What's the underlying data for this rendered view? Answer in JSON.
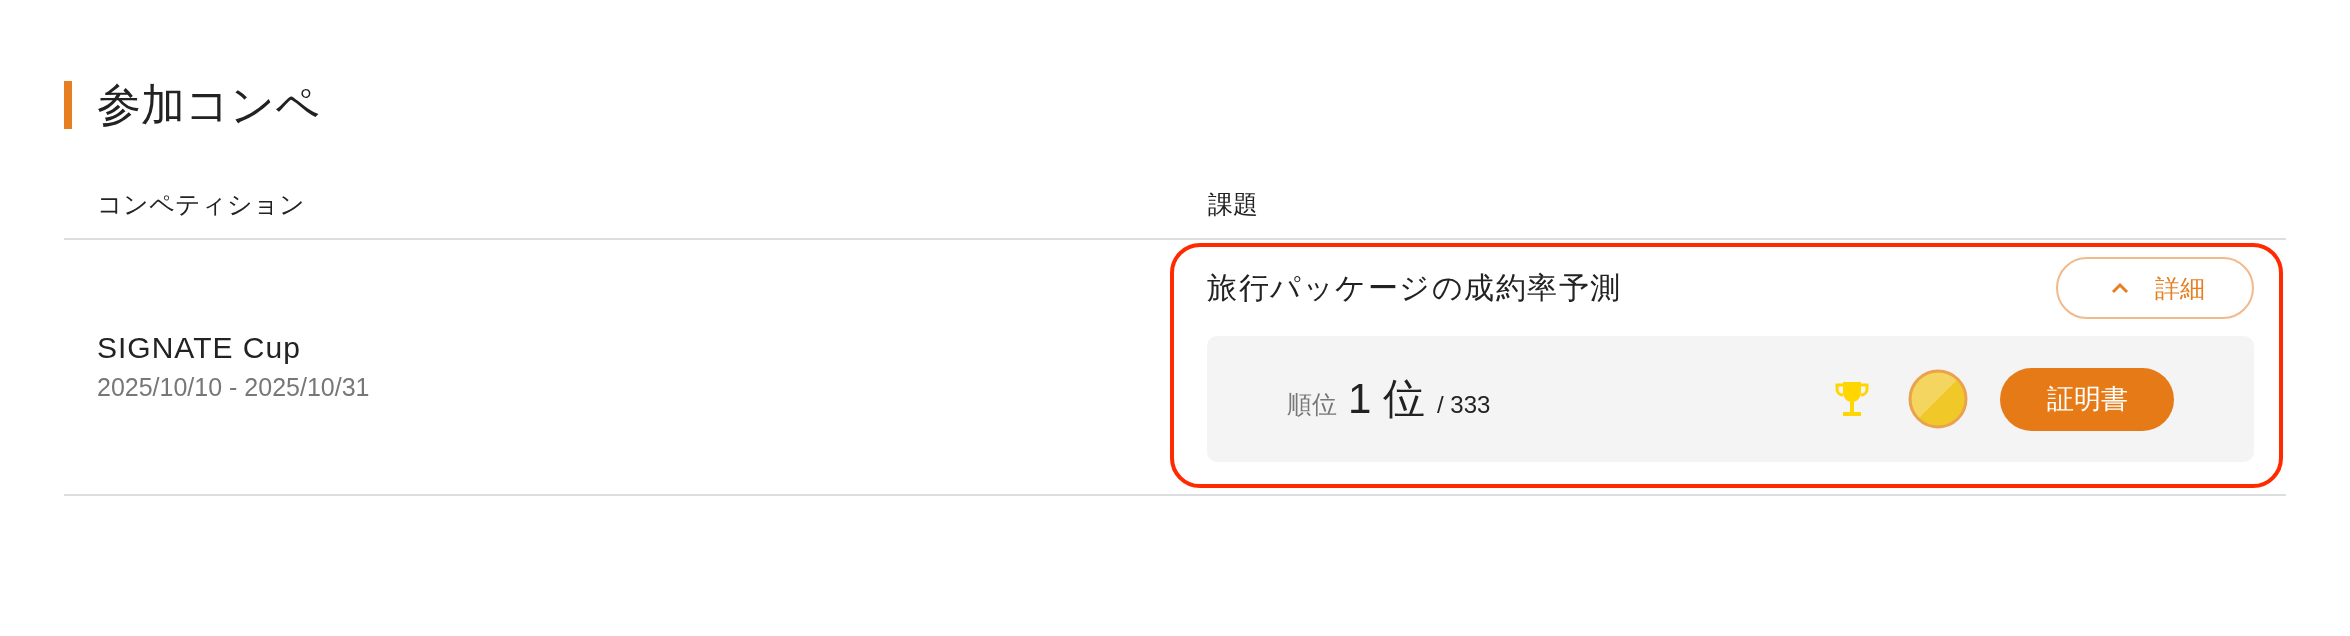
{
  "section": {
    "title": "参加コンペ"
  },
  "table": {
    "columns": [
      "コンペティション",
      "課題"
    ],
    "rows": [
      {
        "highlighted": true,
        "competition": {
          "name": "SIGNATE Cup",
          "period": "2025/10/10 - 2025/10/31"
        },
        "task": {
          "title": "旅行パッケージの成約率予測",
          "detail_button": {
            "label": "詳細",
            "expanded": true
          },
          "result": {
            "rank_label": "順位",
            "rank": "1 位",
            "total": "/ 333",
            "certificate_button": "証明書"
          }
        }
      }
    ]
  }
}
